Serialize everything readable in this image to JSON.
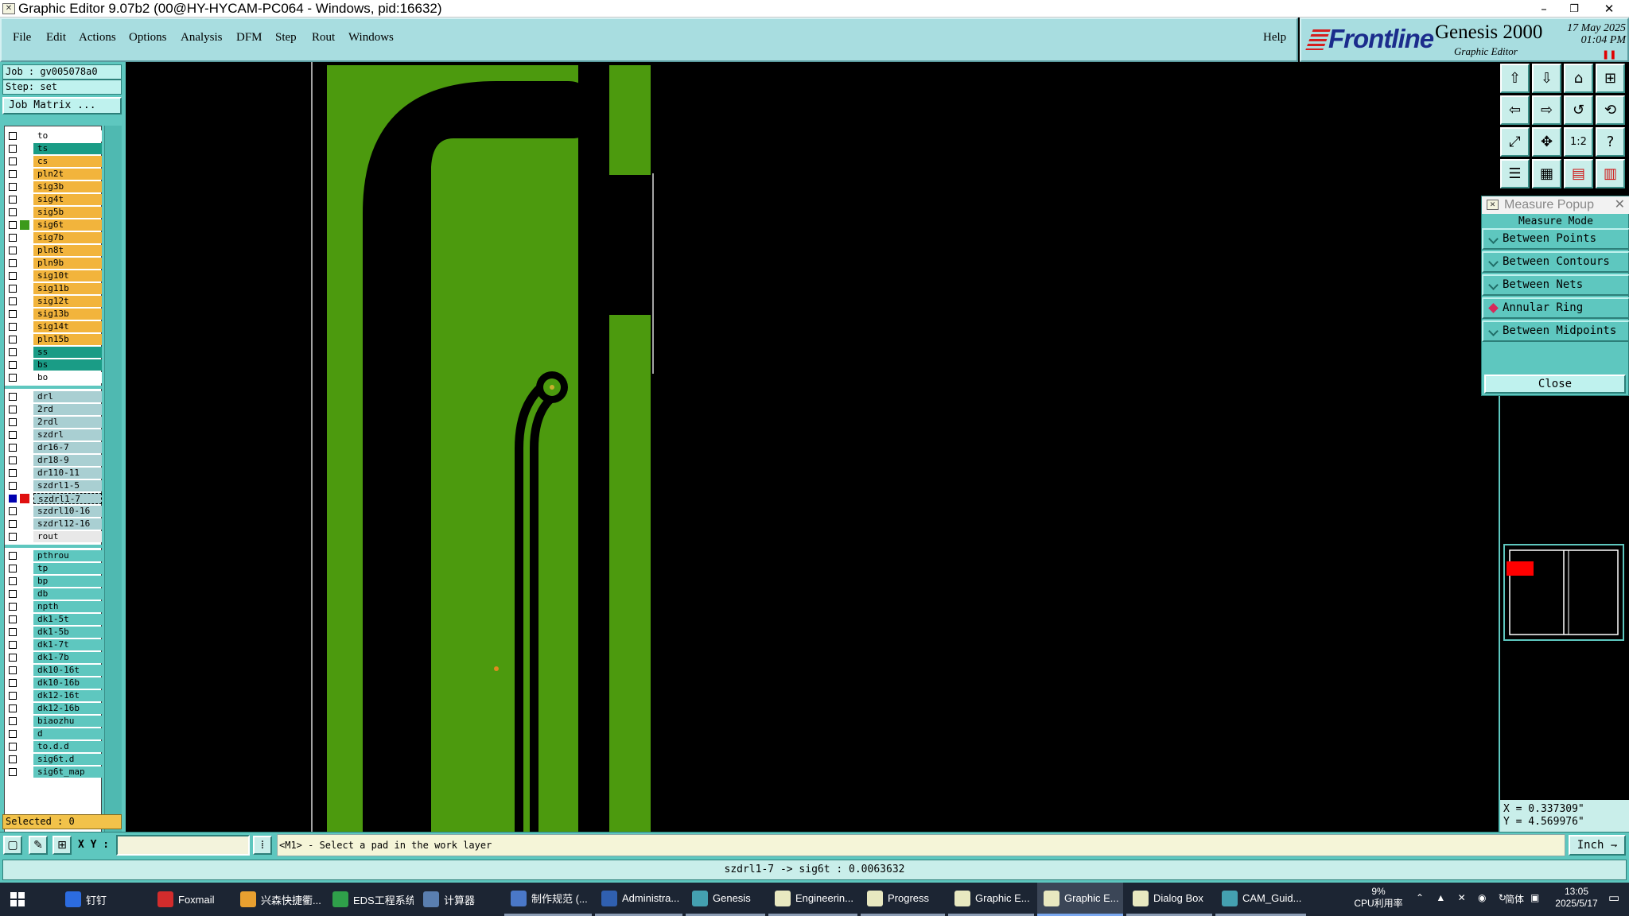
{
  "window": {
    "title": "Graphic Editor 9.07b2 (00@HY-HYCAM-PC064 - Windows, pid:16632)",
    "minimize": "–",
    "restore": "❐",
    "close": "✕"
  },
  "menu": [
    "File",
    "Edit",
    "Actions",
    "Options",
    "Analysis",
    "DFM",
    "Step",
    "Rout",
    "Windows"
  ],
  "help": "Help",
  "brand": {
    "logo": "Frontline",
    "product": "Genesis 2000",
    "subtitle": "Graphic Editor",
    "date": "17 May 2025",
    "time": "01:04 PM"
  },
  "job": {
    "job": "Job : gv005078a0",
    "step": "Step: set",
    "matrix_button": "Job Matrix ..."
  },
  "layers": {
    "group1": [
      {
        "name": "to",
        "color": "#ffffff"
      },
      {
        "name": "ts",
        "color": "#1a9c86"
      },
      {
        "name": "cs",
        "color": "#f2b43c"
      },
      {
        "name": "pln2t",
        "color": "#f2b43c"
      },
      {
        "name": "sig3b",
        "color": "#f2b43c"
      },
      {
        "name": "sig4t",
        "color": "#f2b43c"
      },
      {
        "name": "sig5b",
        "color": "#f2b43c"
      },
      {
        "name": "sig6t",
        "color": "#f2b43c",
        "swatch": "#3c9a1a"
      },
      {
        "name": "sig7b",
        "color": "#f2b43c"
      },
      {
        "name": "pln8t",
        "color": "#f2b43c"
      },
      {
        "name": "pln9b",
        "color": "#f2b43c"
      },
      {
        "name": "sig10t",
        "color": "#f2b43c"
      },
      {
        "name": "sig11b",
        "color": "#f2b43c"
      },
      {
        "name": "sig12t",
        "color": "#f2b43c"
      },
      {
        "name": "sig13b",
        "color": "#f2b43c"
      },
      {
        "name": "sig14t",
        "color": "#f2b43c"
      },
      {
        "name": "pln15b",
        "color": "#f2b43c"
      },
      {
        "name": "ss",
        "color": "#1a9c86"
      },
      {
        "name": "bs",
        "color": "#1a9c86"
      },
      {
        "name": "bo",
        "color": "#ffffff"
      }
    ],
    "group2": [
      {
        "name": "drl",
        "color": "#a9cfd2"
      },
      {
        "name": "2rd",
        "color": "#a9cfd2"
      },
      {
        "name": "2rdl",
        "color": "#a9cfd2"
      },
      {
        "name": "szdrl",
        "color": "#a9cfd2"
      },
      {
        "name": "dr16-7",
        "color": "#a9cfd2"
      },
      {
        "name": "dr18-9",
        "color": "#a9cfd2"
      },
      {
        "name": "dr110-11",
        "color": "#a9cfd2"
      },
      {
        "name": "szdrl1-5",
        "color": "#a9cfd2"
      },
      {
        "name": "szdrl1-7",
        "color": "#a9cfd2",
        "swatch": "#e01010",
        "checked": true,
        "selected": true
      },
      {
        "name": "szdrl10-16",
        "color": "#a9cfd2"
      },
      {
        "name": "szdrl12-16",
        "color": "#a9cfd2"
      },
      {
        "name": "rout",
        "color": "#e8e8e8"
      }
    ],
    "group3": [
      {
        "name": "pthrou",
        "color": "#5ec7bf"
      },
      {
        "name": "tp",
        "color": "#5ec7bf"
      },
      {
        "name": "bp",
        "color": "#5ec7bf"
      },
      {
        "name": "db",
        "color": "#5ec7bf"
      },
      {
        "name": "npth",
        "color": "#5ec7bf"
      },
      {
        "name": "dk1-5t",
        "color": "#5ec7bf"
      },
      {
        "name": "dk1-5b",
        "color": "#5ec7bf"
      },
      {
        "name": "dk1-7t",
        "color": "#5ec7bf"
      },
      {
        "name": "dk1-7b",
        "color": "#5ec7bf"
      },
      {
        "name": "dk10-16t",
        "color": "#5ec7bf"
      },
      {
        "name": "dk10-16b",
        "color": "#5ec7bf"
      },
      {
        "name": "dk12-16t",
        "color": "#5ec7bf"
      },
      {
        "name": "dk12-16b",
        "color": "#5ec7bf"
      },
      {
        "name": "biaozhu",
        "color": "#5ec7bf"
      },
      {
        "name": "d",
        "color": "#5ec7bf"
      },
      {
        "name": "to.d.d",
        "color": "#5ec7bf"
      },
      {
        "name": "sig6t.d",
        "color": "#5ec7bf"
      },
      {
        "name": "sig6t_map",
        "color": "#5ec7bf"
      }
    ]
  },
  "selected": "Selected : 0",
  "measure": {
    "title": "Measure Popup",
    "mode_label": "Measure Mode",
    "options": [
      {
        "label": "Between Points",
        "active": false
      },
      {
        "label": "Between Contours",
        "active": false
      },
      {
        "label": "Between Nets",
        "active": false
      },
      {
        "label": "Annular Ring",
        "active": true
      },
      {
        "label": "Between Midpoints",
        "active": false
      }
    ],
    "close": "Close"
  },
  "coords": {
    "x": "X = 0.337309\"",
    "y": "Y = 4.569976\""
  },
  "bottom": {
    "xy_label": "X Y :",
    "xy_value": "",
    "prompt": "<M1> - Select a pad in the work layer",
    "unit": "Inch"
  },
  "status": "szdrl1-7 -> sig6t : 0.0063632",
  "colors": {
    "copper": "#4c9a0e",
    "background": "#000000",
    "panel": "#5ec7bf",
    "menu": "#a8dde0"
  },
  "taskbar": {
    "items": [
      {
        "label": "钉钉",
        "color": "#2c6ce0"
      },
      {
        "label": "Foxmail",
        "color": "#d22c2c"
      },
      {
        "label": "兴森快捷衢...",
        "color": "#e8a030"
      },
      {
        "label": "EDS工程系统",
        "color": "#2fa04a"
      },
      {
        "label": "计算器",
        "color": "#5a7fb0"
      },
      {
        "label": "制作规范 (...",
        "color": "#4a78c8"
      },
      {
        "label": "Administra...",
        "color": "#3060b0"
      },
      {
        "label": "Genesis",
        "color": "#44a0b0"
      },
      {
        "label": "Engineerin...",
        "color": "#e8e8c0"
      },
      {
        "label": "Progress",
        "color": "#e8e8c0"
      },
      {
        "label": "Graphic E...",
        "color": "#e8e8c0"
      },
      {
        "label": "Graphic E...",
        "color": "#e8e8c0",
        "active": true
      },
      {
        "label": "Dialog Box",
        "color": "#e8e8c0"
      },
      {
        "label": "CAM_Guid...",
        "color": "#44a0b0"
      }
    ],
    "cpu": "9%",
    "cpu_label": "CPU利用率",
    "ime": "简体",
    "clock_time": "13:05",
    "clock_date": "2025/5/17"
  }
}
